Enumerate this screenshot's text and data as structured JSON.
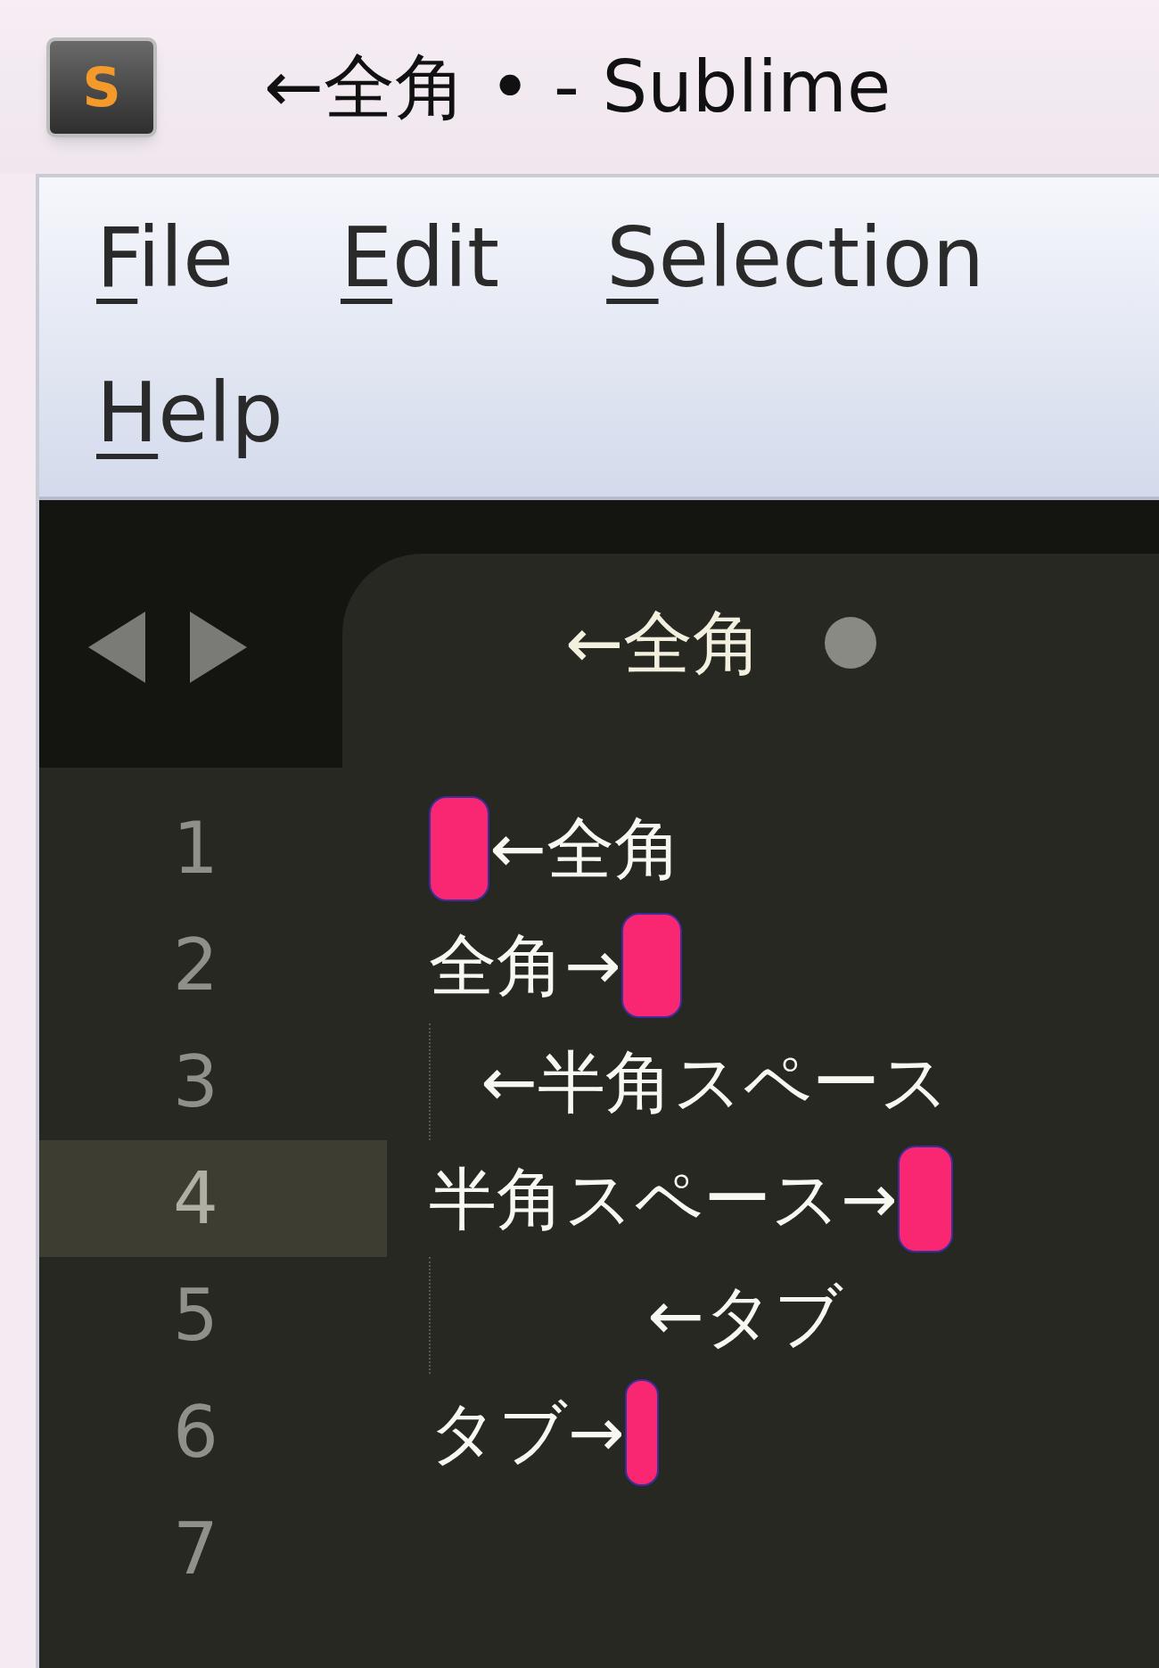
{
  "title_bar": {
    "app_icon": "S",
    "title": "←全角 • - Sublime"
  },
  "menu": {
    "rows": [
      [
        "File",
        "Edit",
        "Selection"
      ],
      [
        "Help"
      ]
    ]
  },
  "tab_bar": {
    "tabs": [
      {
        "label": "←全角",
        "modified": true
      }
    ]
  },
  "editor": {
    "lines": [
      {
        "number": "1",
        "current": false,
        "tokens": [
          {
            "kind": "wide_mark"
          },
          {
            "kind": "text",
            "text": "←全角"
          }
        ]
      },
      {
        "number": "2",
        "current": false,
        "tokens": [
          {
            "kind": "text",
            "text": "全角→"
          },
          {
            "kind": "wide_mark"
          }
        ]
      },
      {
        "number": "3",
        "current": false,
        "tokens": [
          {
            "kind": "space"
          },
          {
            "kind": "text",
            "text": "←半角スペース"
          }
        ]
      },
      {
        "number": "4",
        "current": true,
        "tokens": [
          {
            "kind": "text",
            "text": "半角スペース→"
          },
          {
            "kind": "narrow_mark"
          }
        ]
      },
      {
        "number": "5",
        "current": false,
        "tokens": [
          {
            "kind": "tab"
          },
          {
            "kind": "text",
            "text": "←タブ"
          }
        ]
      },
      {
        "number": "6",
        "current": false,
        "tokens": [
          {
            "kind": "text",
            "text": "タブ→"
          },
          {
            "kind": "thin_mark"
          }
        ]
      },
      {
        "number": "7",
        "current": false
      }
    ]
  }
}
